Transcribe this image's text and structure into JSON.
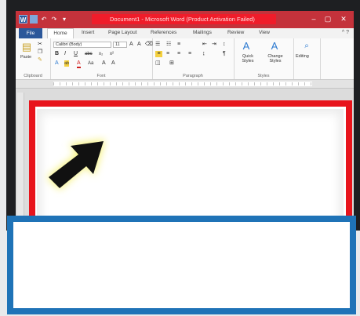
{
  "window": {
    "title": "Document1 - Microsoft Word (Product Activation Failed)",
    "controls": [
      "–",
      "▢",
      "✕"
    ],
    "help": "^ ?"
  },
  "quick_access": {
    "word": "W",
    "save": "",
    "undo": "↶",
    "redo": "↷",
    "customize": "▾"
  },
  "tabs": {
    "file": "File",
    "home": "Home",
    "others": [
      "Insert",
      "Page Layout",
      "References",
      "Mailings",
      "Review",
      "View"
    ]
  },
  "ribbon": {
    "clipboard": {
      "label": "Clipboard",
      "paste": "Paste"
    },
    "font": {
      "label": "Font",
      "font_name": "Calibri (Body)",
      "font_size": "11",
      "row2": [
        "B",
        "I",
        "U",
        "abc",
        "x₂",
        "x²"
      ],
      "row3": [
        "A",
        "ab",
        "A",
        "Aa",
        "A",
        "A"
      ]
    },
    "paragraph": {
      "label": "Paragraph"
    },
    "styles": {
      "label": "Styles",
      "quick_styles": "Quick Styles",
      "change_styles": "Change Styles"
    },
    "editing": {
      "label": "Editing"
    }
  },
  "colors": {
    "title_bar": "#c4323b",
    "title_highlight": "#f01c2a",
    "file_tab": "#2b579a",
    "red_annotation": "#e8141c",
    "blue_annotation": "#1f73b7",
    "arrow": "#111111",
    "arrow_glow": "#f6f27a"
  }
}
